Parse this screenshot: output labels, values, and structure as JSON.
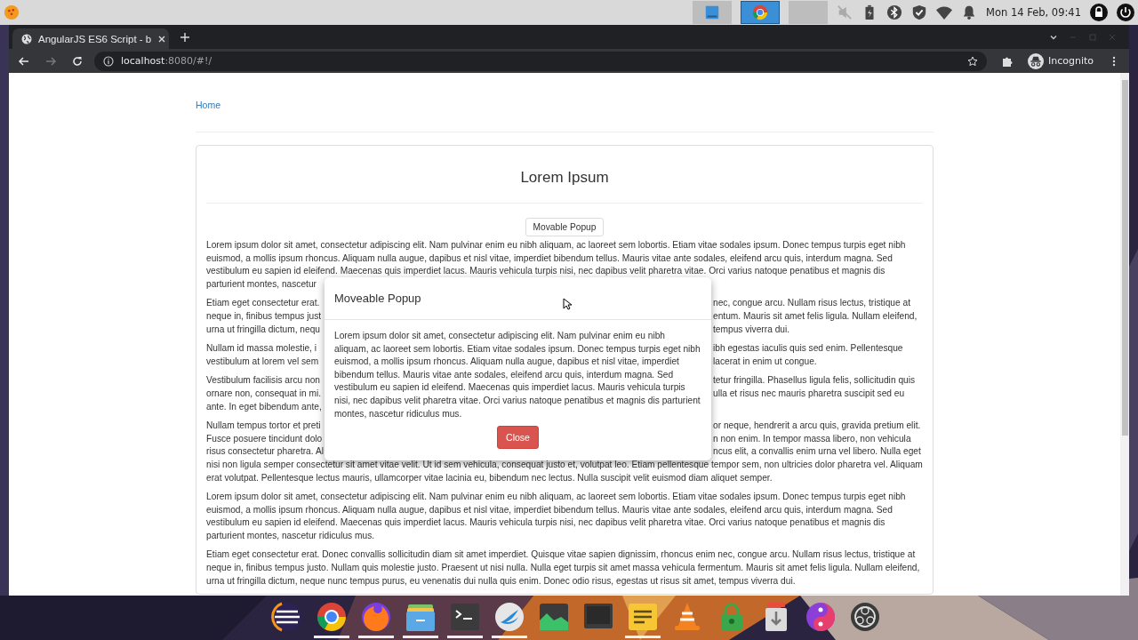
{
  "top_panel": {
    "windows": [
      {
        "kind": "monitor",
        "selected": false
      },
      {
        "kind": "browser",
        "selected": true
      },
      {
        "kind": "blank",
        "selected": false
      }
    ],
    "clock": "Mon 14 Feb, 09:41"
  },
  "browser": {
    "tabs": [
      {
        "title": "AngularJS ES6 Script - b",
        "selected": true
      }
    ],
    "nav": [
      {
        "kind": "back",
        "disabled": false
      },
      {
        "kind": "forward",
        "disabled": true
      },
      {
        "kind": "reload",
        "disabled": false
      }
    ],
    "url_host": "localhost",
    "url_rest": ":8080/#!/",
    "profile": "Incognito"
  },
  "page": {
    "breadcrumb": "Home",
    "panel_title": "Lorem Ipsum",
    "open_button": "Movable Popup",
    "paragraphs": [
      {
        "lines": [
          {
            "left": "Lorem ipsum dolor sit amet, consectetur adipiscing elit. Nam pulvinar enim eu nibh aliquam, ac laoreet sem lobortis. Etiam vitae sodales ipsum. Donec tempus turpis eget nibh"
          },
          {
            "left": "euismod, a mollis ipsum rhoncus. Aliquam nulla augue, dapibus et nisl vitae, imperdiet bibendum tellus. Mauris vitae ante sodales, eleifend arcu quis, interdum magna. Sed"
          },
          {
            "left": "vestibulum eu sapien id eleifend. Maecenas quis imperdiet lacus. Mauris vehicula turpis nisi, nec dapibus velit pharetra vitae. Orci varius natoque penatibus et magnis dis"
          },
          {
            "left": "parturient montes, nascetur"
          }
        ]
      },
      {
        "lines": [
          {
            "left": "Etiam eget consectetur erat.",
            "right": "nec, congue arcu. Nullam risus lectus, tristique at"
          },
          {
            "left": "neque in, finibus tempus just",
            "right": "entum. Mauris sit amet felis ligula. Nullam eleifend,"
          },
          {
            "left": "urna ut fringilla dictum, nequ",
            "right": "tempus viverra dui."
          }
        ]
      },
      {
        "lines": [
          {
            "left": "Nullam id massa molestie, i",
            "right": "ibh egestas iaculis quis sed enim. Pellentesque"
          },
          {
            "left": "vestibulum at lorem vel sem",
            "right": "lacerat in enim ut congue."
          }
        ]
      },
      {
        "lines": [
          {
            "left": "Vestibulum facilisis arcu non",
            "right": "tetur fringilla. Phasellus ligula felis, sollicitudin quis"
          },
          {
            "left": "ornare non, consequat in mi.",
            "right": "ulla et risus nec mauris pharetra suscipit sed eu"
          },
          {
            "left": "ante. In eget bibendum ante,"
          }
        ]
      },
      {
        "lines": [
          {
            "left": "Nullam tempus tortor et preti",
            "right": "or neque, hendrerit a arcu quis, gravida pretium elit."
          },
          {
            "left": "Fusce posuere tincidunt dolo",
            "right": "n non enim. In tempor massa libero, non vehicula"
          },
          {
            "left": "risus consectetur pharetra. Al",
            "right": "ncus elit, a convallis enim urna vel libero. Nulla eget"
          },
          {
            "left": "nisi non ligula semper consectetur sit amet vitae velit. Ut id sem vehicula, consequat justo et, volutpat leo. Etiam pellentesque tempor sem, non ultricies dolor pharetra vel. Aliquam"
          },
          {
            "left": "erat volutpat. Pellentesque lectus mauris, ullamcorper vitae lacinia eu, bibendum nec lectus. Nulla suscipit velit euismod diam aliquet semper."
          }
        ]
      },
      {
        "lines": [
          {
            "left": "Lorem ipsum dolor sit amet, consectetur adipiscing elit. Nam pulvinar enim eu nibh aliquam, ac laoreet sem lobortis. Etiam vitae sodales ipsum. Donec tempus turpis eget nibh"
          },
          {
            "left": "euismod, a mollis ipsum rhoncus. Aliquam nulla augue, dapibus et nisl vitae, imperdiet bibendum tellus. Mauris vitae ante sodales, eleifend arcu quis, interdum magna. Sed"
          },
          {
            "left": "vestibulum eu sapien id eleifend. Maecenas quis imperdiet lacus. Mauris vehicula turpis nisi, nec dapibus velit pharetra vitae. Orci varius natoque penatibus et magnis dis"
          },
          {
            "left": "parturient montes, nascetur ridiculus mus."
          }
        ]
      },
      {
        "lines": [
          {
            "left": "Etiam eget consectetur erat. Donec convallis sollicitudin diam sit amet imperdiet. Quisque vitae sapien dignissim, rhoncus enim nec, congue arcu. Nullam risus lectus, tristique at"
          },
          {
            "left": "neque in, finibus tempus justo. Nullam quis molestie justo. Praesent ut nisi nulla. Nulla eget turpis sit amet massa vehicula fermentum. Mauris sit amet felis ligula. Nullam eleifend,"
          },
          {
            "left": "urna ut fringilla dictum, neque nunc tempus purus, eu venenatis dui nulla quis enim. Donec odio risus, egestas ut risus sit amet, tempus viverra dui."
          }
        ]
      }
    ]
  },
  "popup": {
    "title": "Moveable Popup",
    "body": "Lorem ipsum dolor sit amet, consectetur adipiscing elit. Nam pulvinar enim eu nibh aliquam, ac laoreet sem lobortis. Etiam vitae sodales ipsum. Donec tempus turpis eget nibh euismod, a mollis ipsum rhoncus. Aliquam nulla augue, dapibus et nisl vitae, imperdiet bibendum tellus. Mauris vitae ante sodales, eleifend arcu quis, interdum magna. Sed vestibulum eu sapien id eleifend. Maecenas quis imperdiet lacus. Mauris vehicula turpis nisi, nec dapibus velit pharetra vitae. Orci varius natoque penatibus et magnis dis parturient montes, nascetur ridiculus mus.",
    "close_button": "Close"
  },
  "dock": [
    {
      "kind": "ring",
      "running": false
    },
    {
      "kind": "browser",
      "running": true
    },
    {
      "kind": "fox",
      "running": true
    },
    {
      "kind": "files",
      "running": true
    },
    {
      "kind": "terminal",
      "running": true
    },
    {
      "kind": "bird",
      "running": true
    },
    {
      "kind": "chart",
      "running": false
    },
    {
      "kind": "monitor",
      "running": false
    },
    {
      "kind": "notes",
      "running": true
    },
    {
      "kind": "cone",
      "running": false
    },
    {
      "kind": "lock",
      "running": false
    },
    {
      "kind": "download",
      "running": false
    },
    {
      "kind": "yinyang",
      "running": false
    },
    {
      "kind": "record",
      "running": false
    }
  ]
}
